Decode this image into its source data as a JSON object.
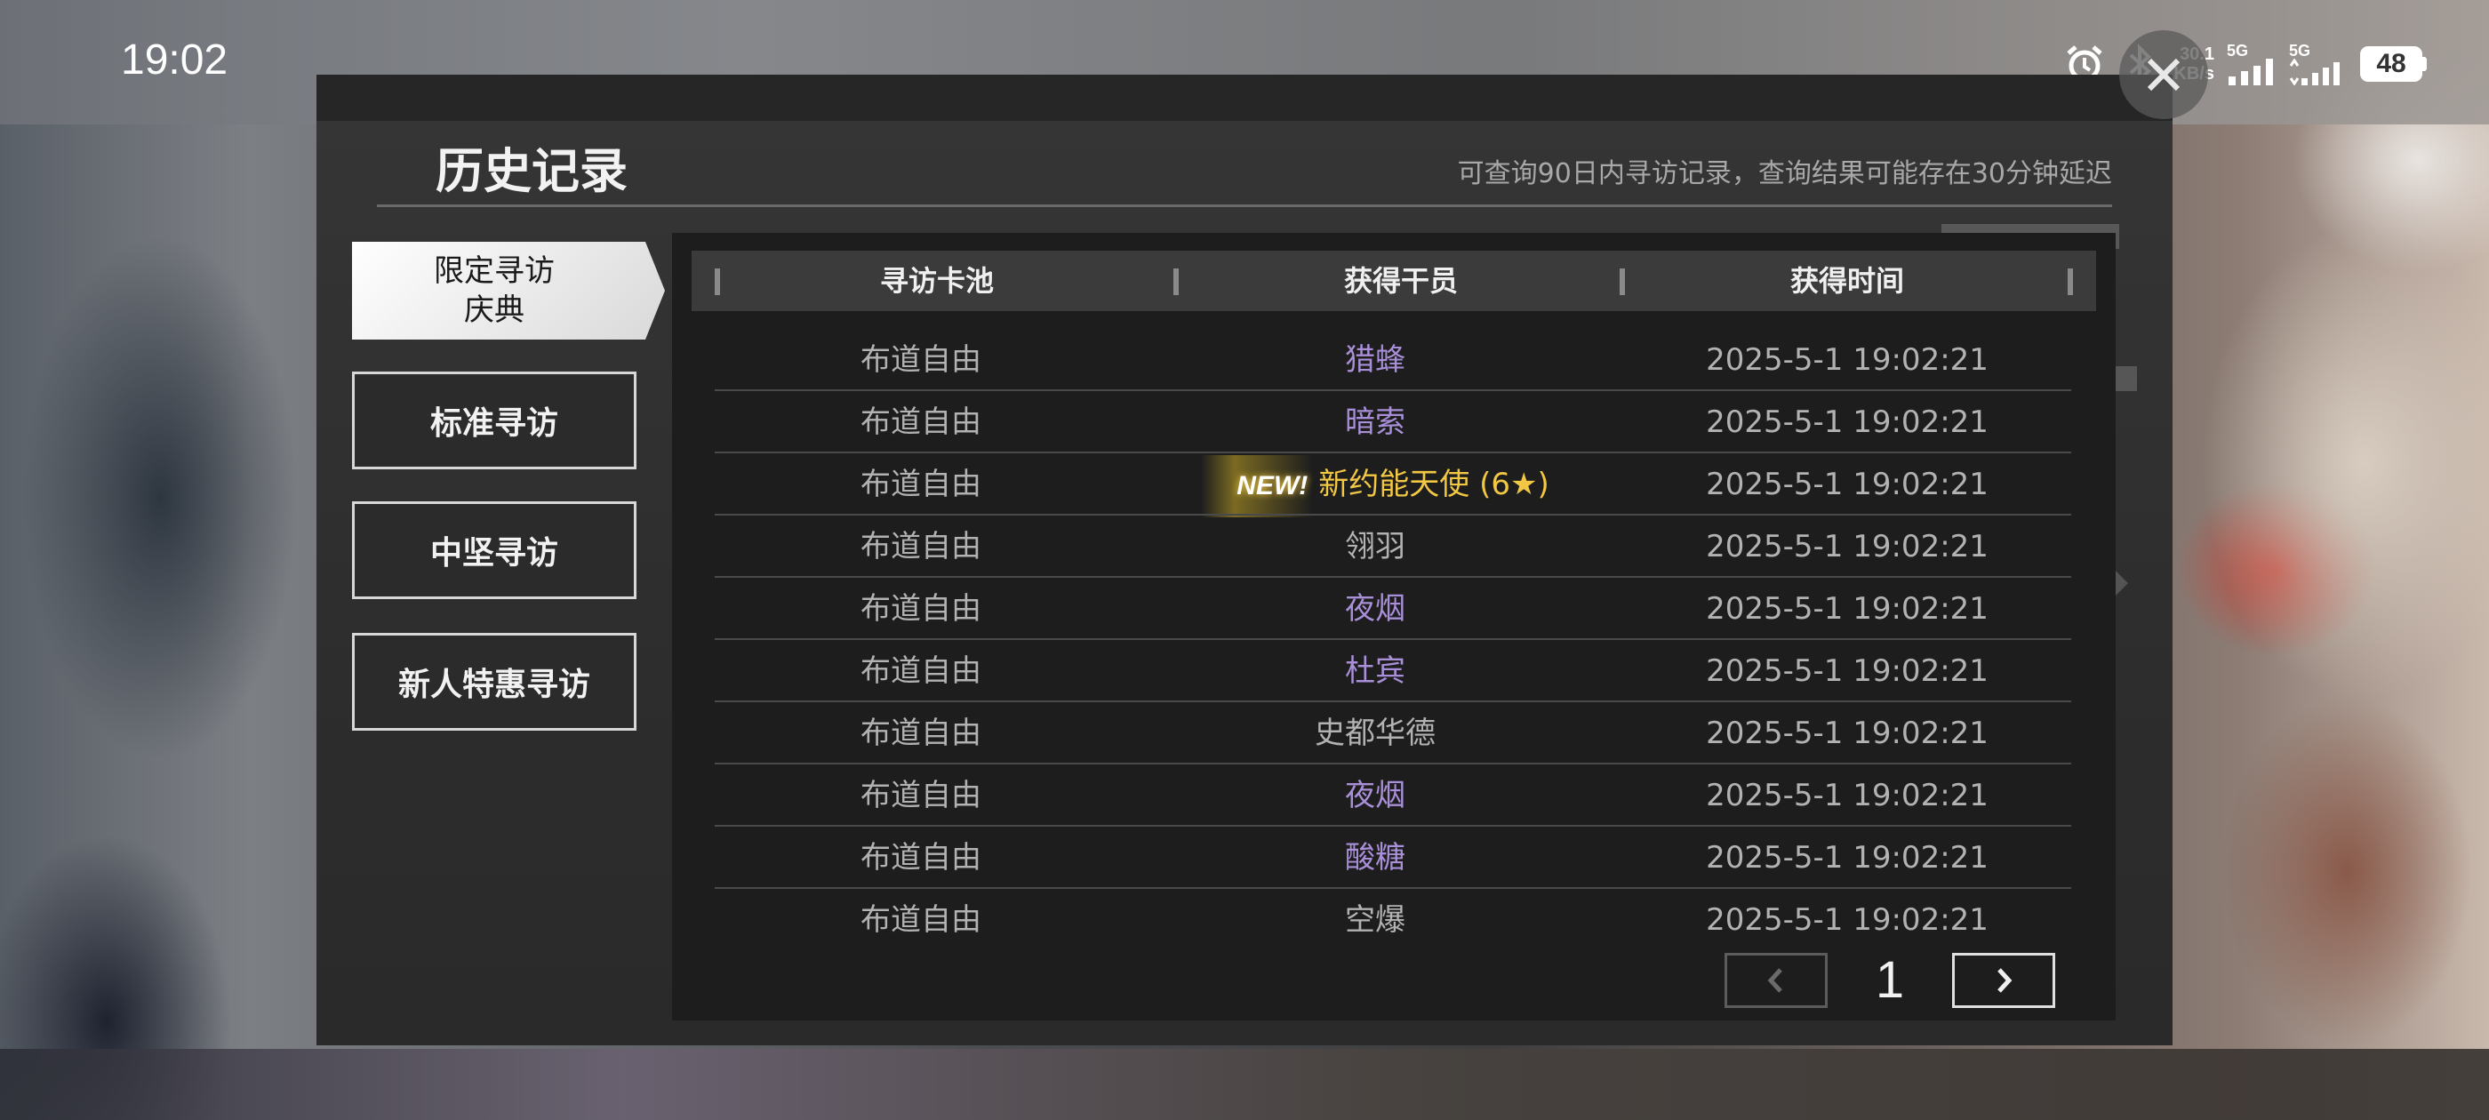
{
  "status_bar": {
    "time": "19:02",
    "net_speed_value": "30.1",
    "net_speed_unit": "KB/s",
    "signal1_label": "5G",
    "signal2_label": "5G",
    "battery": "48",
    "icons": [
      "alarm-icon",
      "bluetooth-icon",
      "signal-icon",
      "battery-icon"
    ]
  },
  "header": {
    "title": "历史记录",
    "hint": "可查询90日内寻访记录，查询结果可能存在30分钟延迟"
  },
  "sidebar": {
    "active_tab_line1": "限定寻访",
    "active_tab_line2": "庆典",
    "tabs": [
      "标准寻访",
      "中坚寻访",
      "新人特惠寻访"
    ]
  },
  "table": {
    "columns": [
      "寻访卡池",
      "获得干员",
      "获得时间"
    ],
    "rows": [
      {
        "pool": "布道自由",
        "operator": "猎蜂",
        "time": "2025-5-1 19:02:21"
      },
      {
        "pool": "布道自由",
        "operator": "暗索",
        "time": "2025-5-1 19:02:21"
      },
      {
        "pool": "布道自由",
        "operator": "新约能天使 (6★)",
        "time": "2025-5-1 19:02:21",
        "badge": "NEW!"
      },
      {
        "pool": "布道自由",
        "operator": "翎羽",
        "time": "2025-5-1 19:02:21"
      },
      {
        "pool": "布道自由",
        "operator": "夜烟",
        "time": "2025-5-1 19:02:21"
      },
      {
        "pool": "布道自由",
        "operator": "杜宾",
        "time": "2025-5-1 19:02:21"
      },
      {
        "pool": "布道自由",
        "operator": "史都华德",
        "time": "2025-5-1 19:02:21"
      },
      {
        "pool": "布道自由",
        "operator": "夜烟",
        "time": "2025-5-1 19:02:21"
      },
      {
        "pool": "布道自由",
        "operator": "酸糖",
        "time": "2025-5-1 19:02:21"
      },
      {
        "pool": "布道自由",
        "operator": "空爆",
        "time": "2025-5-1 19:02:21"
      }
    ],
    "row_colors": [
      "#a88fd8",
      "#a88fd8",
      "#f2c744",
      "#b2b2b2",
      "#a88fd8",
      "#a88fd8",
      "#b2b2b2",
      "#a88fd8",
      "#a88fd8",
      "#b2b2b2"
    ]
  },
  "pagination": {
    "current_page": "1",
    "prev_icon": "chevron-left-icon",
    "next_icon": "chevron-right-icon"
  },
  "colors": {
    "rarity_4_star": "#a88fd8",
    "rarity_6_star": "#f2c744",
    "rarity_3_star": "#b2b2b2"
  }
}
